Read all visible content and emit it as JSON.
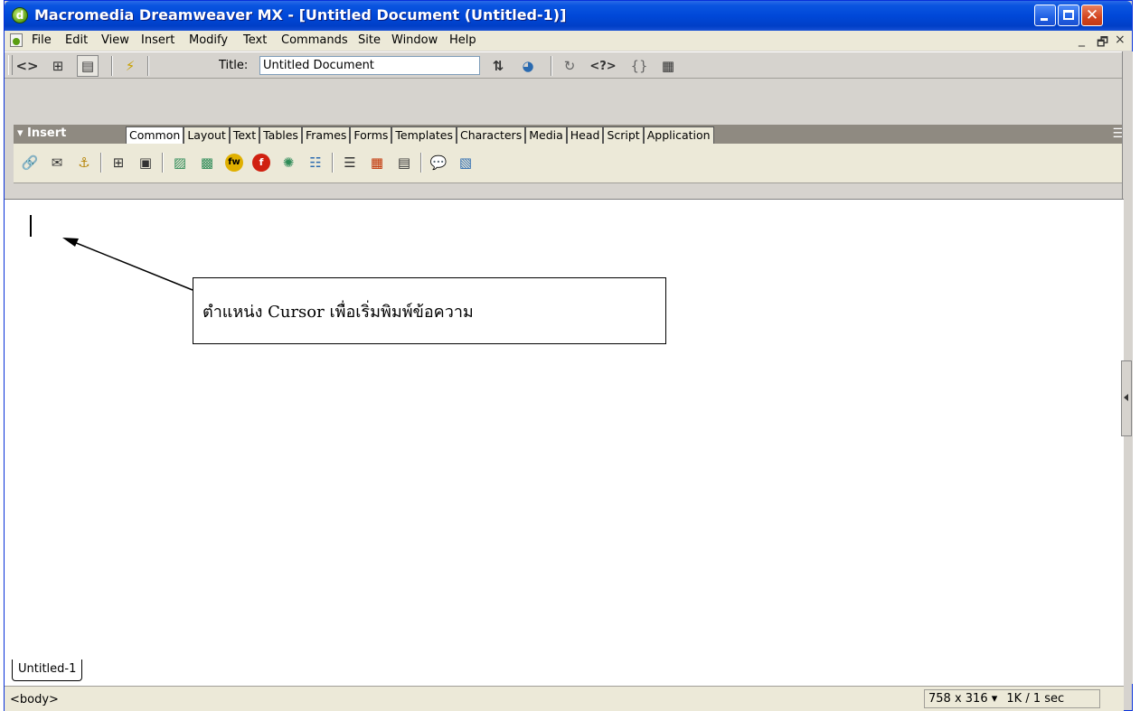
{
  "window": {
    "title": "Macromedia Dreamweaver MX - [Untitled Document (Untitled-1)]"
  },
  "menu": {
    "items": [
      "File",
      "Edit",
      "View",
      "Insert",
      "Modify",
      "Text",
      "Commands",
      "Site",
      "Window",
      "Help"
    ],
    "mdi_controls": [
      "_",
      "ā",
      "×"
    ]
  },
  "doc_toolbar": {
    "title_label": "Title:",
    "title_value": "Untitled Document"
  },
  "insert_bar": {
    "label": "▾ Insert",
    "tabs": [
      "Common",
      "Layout",
      "Text",
      "Tables",
      "Frames",
      "Forms",
      "Templates",
      "Characters",
      "Media",
      "Head",
      "Script",
      "Application"
    ],
    "active_tab": "Common",
    "icons": [
      "hyperlink-icon",
      "email-link-icon",
      "named-anchor-icon",
      "table-icon",
      "layer-icon",
      "image-icon",
      "image-placeholder-icon",
      "fireworks-html-icon",
      "flash-icon",
      "rollover-image-icon",
      "navigation-bar-icon",
      "horizontal-rule-icon",
      "date-icon",
      "tabular-data-icon",
      "comment-icon",
      "tag-chooser-icon"
    ]
  },
  "document": {
    "callout_text": "ตำแหน่ง Cursor เพื่อเริ่มพิมพ์ข้อความ"
  },
  "doc_tab": {
    "label": "Untitled-1"
  },
  "status": {
    "tag_selector": "<body>",
    "window_size": "758 x 316 ▾",
    "download": "1K / 1 sec"
  }
}
